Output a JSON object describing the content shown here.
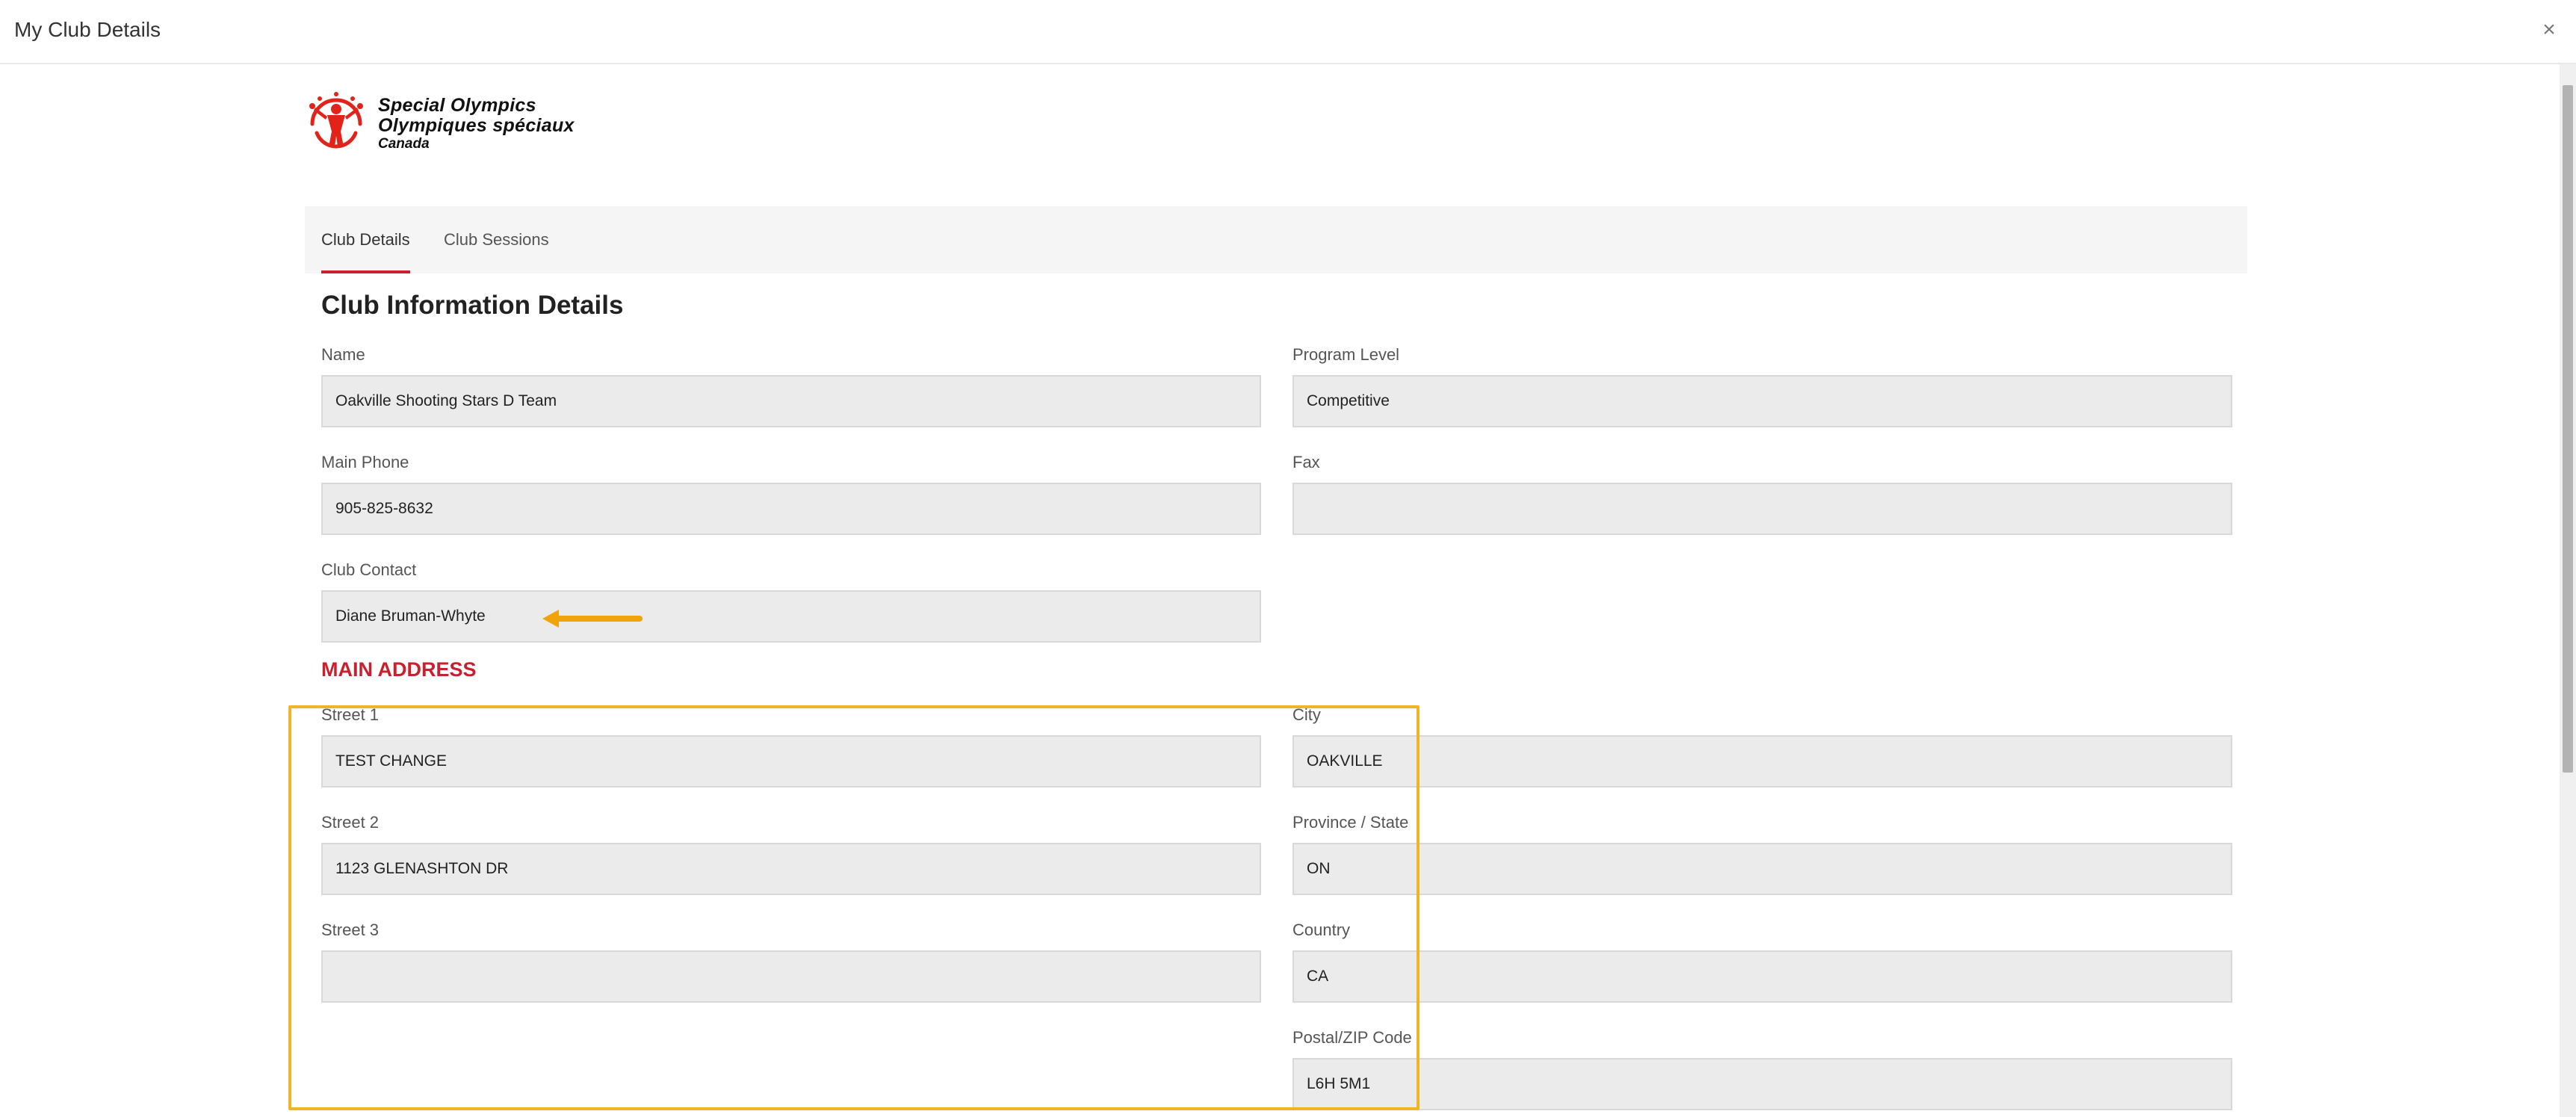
{
  "window": {
    "title": "My Club Details",
    "close_label": "×"
  },
  "logo": {
    "line1": "Special Olympics",
    "line2": "Olympiques spéciaux",
    "line3": "Canada"
  },
  "tabs": [
    {
      "label": "Club Details",
      "active": true
    },
    {
      "label": "Club Sessions",
      "active": false
    }
  ],
  "section_title": "Club Information Details",
  "fields": {
    "name": {
      "label": "Name",
      "value": "Oakville Shooting Stars D Team"
    },
    "program_level": {
      "label": "Program Level",
      "value": "Competitive"
    },
    "main_phone": {
      "label": "Main Phone",
      "value": "905-825-8632"
    },
    "fax": {
      "label": "Fax",
      "value": ""
    },
    "club_contact": {
      "label": "Club Contact",
      "value": "Diane Bruman-Whyte"
    }
  },
  "address": {
    "heading": "MAIN ADDRESS",
    "street1": {
      "label": "Street 1",
      "value": "TEST CHANGE"
    },
    "street2": {
      "label": "Street 2",
      "value": "1123 GLENASHTON DR"
    },
    "street3": {
      "label": "Street 3",
      "value": ""
    },
    "city": {
      "label": "City",
      "value": "OAKVILLE"
    },
    "province": {
      "label": "Province / State",
      "value": "ON"
    },
    "country": {
      "label": "Country",
      "value": "CA"
    },
    "postal": {
      "label": "Postal/ZIP Code",
      "value": "L6H 5M1"
    }
  },
  "colors": {
    "accent": "#c9202e",
    "highlight": "#f0b429",
    "field_bg": "#ebebeb"
  }
}
